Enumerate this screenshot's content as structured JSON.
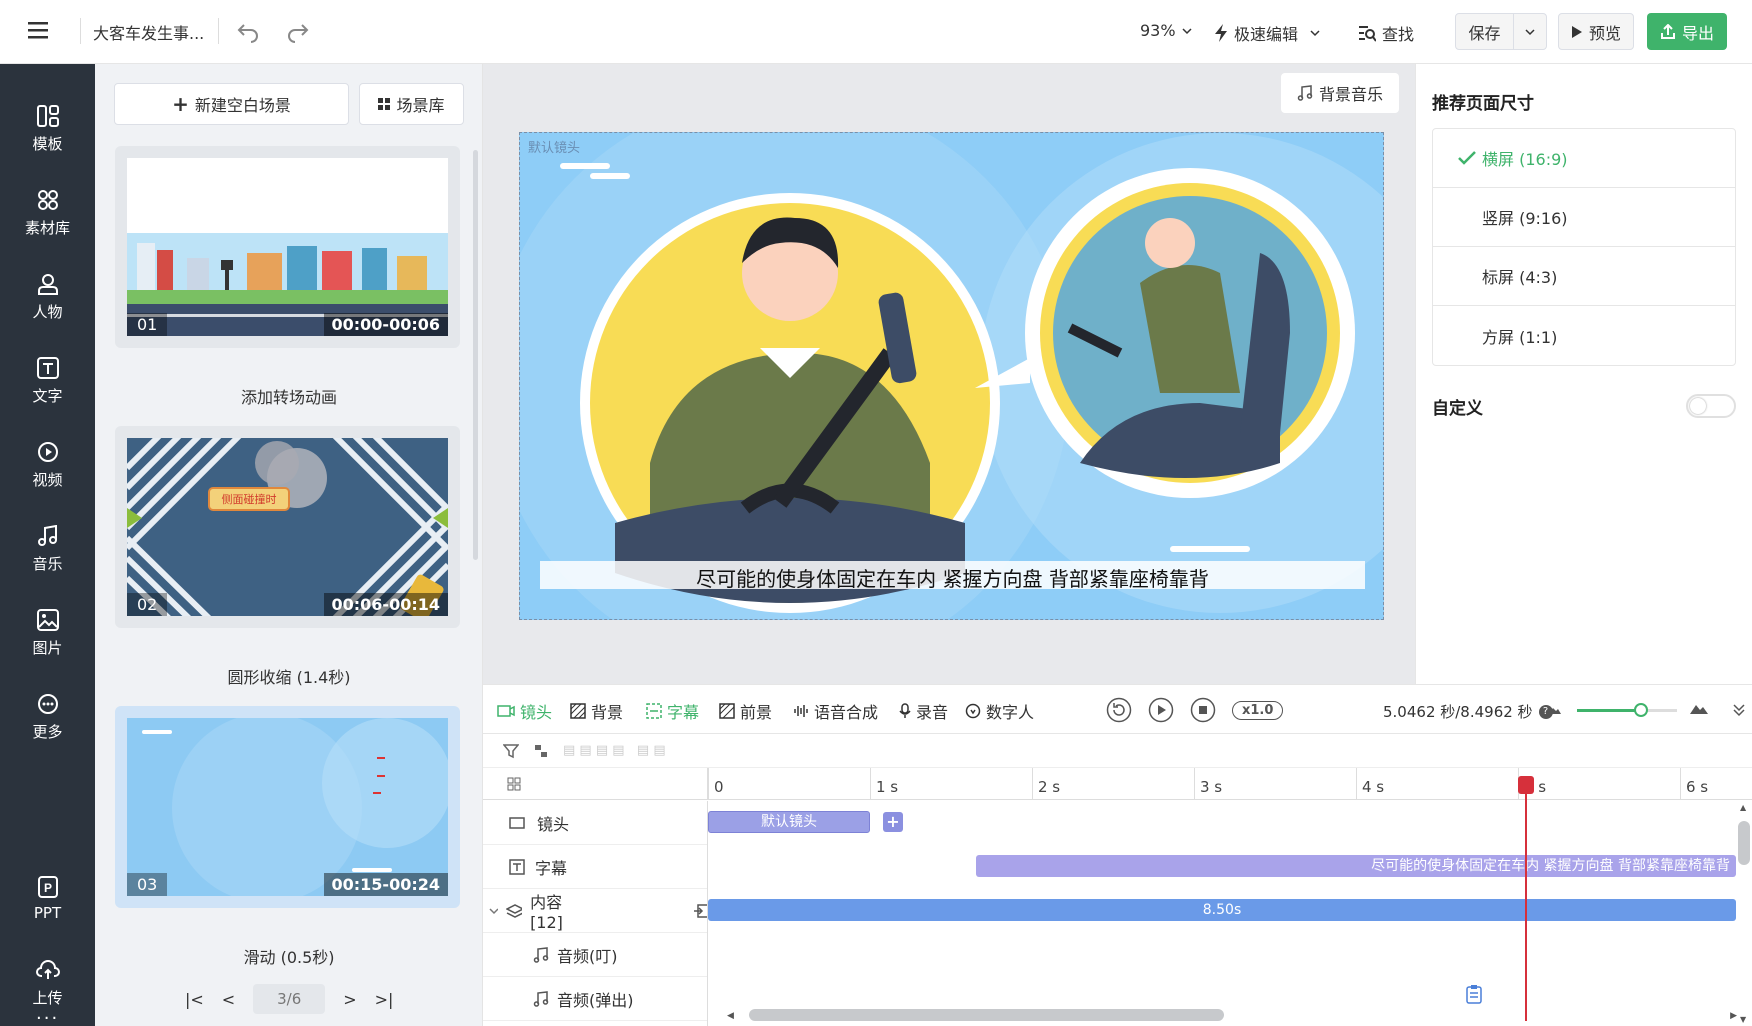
{
  "topbar": {
    "title": "大客车发生事...",
    "zoom": "93%",
    "mode": "极速编辑",
    "find": "查找",
    "save": "保存",
    "preview": "预览",
    "export": "导出"
  },
  "sidebar": {
    "items": [
      {
        "label": "模板",
        "icon": "template-icon"
      },
      {
        "label": "素材库",
        "icon": "assets-icon"
      },
      {
        "label": "人物",
        "icon": "person-icon"
      },
      {
        "label": "文字",
        "icon": "text-icon"
      },
      {
        "label": "视频",
        "icon": "video-icon"
      },
      {
        "label": "音乐",
        "icon": "music-icon"
      },
      {
        "label": "图片",
        "icon": "image-icon"
      },
      {
        "label": "更多",
        "icon": "more-icon"
      },
      {
        "label": "PPT",
        "icon": "ppt-icon"
      },
      {
        "label": "上传",
        "icon": "upload-icon"
      }
    ]
  },
  "scenes": {
    "new_blank": "新建空白场景",
    "library": "场景库",
    "cards": [
      {
        "num": "01",
        "time": "00:00-00:06",
        "label": "添加转场动画"
      },
      {
        "num": "02",
        "time": "00:06-00:14",
        "label": "圆形收缩 (1.4秒)",
        "sign": "侧面碰撞时"
      },
      {
        "num": "03",
        "time": "00:15-00:24",
        "label": "滑动 (0.5秒)"
      }
    ],
    "pager": "3/6"
  },
  "canvas": {
    "bg_music": "背景音乐",
    "lens_tag": "默认镜头",
    "subtitle": "尽可能的使身体固定在车内  紧握方向盘  背部紧靠座椅靠背"
  },
  "right": {
    "title": "推荐页面尺寸",
    "options": [
      "横屏 (16:9)",
      "竖屏 (9:16)",
      "标屏 (4:3)",
      "方屏 (1:1)"
    ],
    "selected": 0,
    "custom": "自定义",
    "custom_enabled": false
  },
  "timeline": {
    "tabs": [
      "镜头",
      "背景",
      "字幕",
      "前景",
      "语音合成",
      "录音",
      "数字人"
    ],
    "speed": "x1.0",
    "time": "5.0462 秒/8.4962 秒",
    "ticks": [
      "0",
      "1 s",
      "2 s",
      "3 s",
      "4 s",
      "5 s",
      "6 s"
    ],
    "playhead_seconds": 5.05,
    "tracks": [
      {
        "label": "镜头",
        "clip": "默认镜头"
      },
      {
        "label": "字幕",
        "clip": "尽可能的使身体固定在车内  紧握方向盘  背部紧靠座椅靠背"
      },
      {
        "label": "内容 [12]",
        "clip": "8.50s"
      },
      {
        "label": "音频(叮)"
      },
      {
        "label": "音频(弹出)"
      }
    ]
  },
  "colors": {
    "accent": "#3fb36b",
    "sidebar": "#2b333d",
    "clip_purple": "#9ba0e6",
    "clip_blue": "#6a9ae8",
    "playhead": "#d6303b"
  }
}
